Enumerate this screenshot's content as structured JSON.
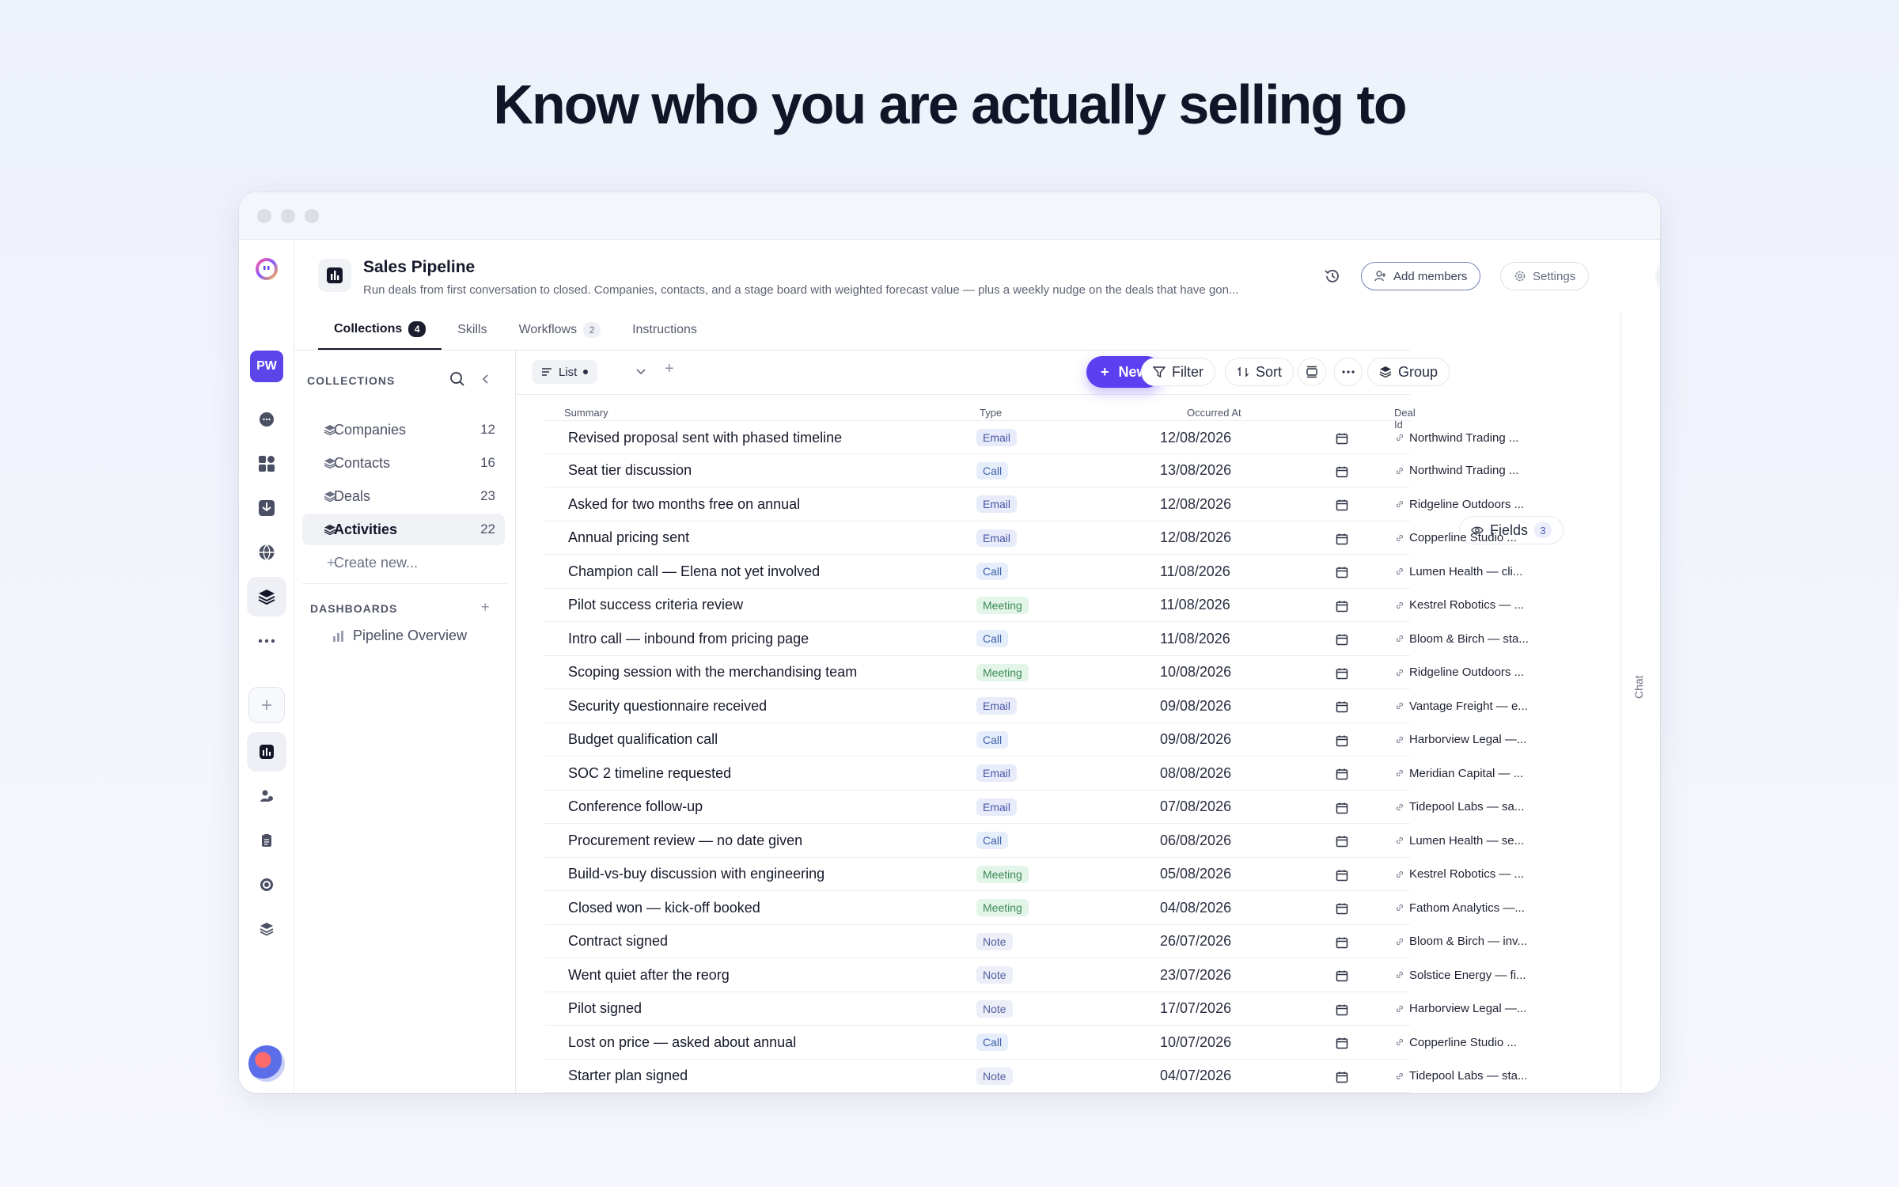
{
  "hero": {
    "title": "Know who you are actually selling to"
  },
  "workspace": {
    "initials": "PW"
  },
  "header": {
    "title": "Sales Pipeline",
    "description": "Run deals from first conversation to closed. Companies, contacts, and a stage board with weighted forecast value — plus a weekly nudge on the deals that have gon...",
    "add_members": "Add members",
    "settings": "Settings"
  },
  "tabs": [
    {
      "label": "Collections",
      "count": "4"
    },
    {
      "label": "Skills"
    },
    {
      "label": "Workflows",
      "count": "2"
    },
    {
      "label": "Instructions"
    }
  ],
  "sidebar": {
    "collections_heading": "COLLECTIONS",
    "collections": [
      {
        "label": "Companies",
        "count": "12"
      },
      {
        "label": "Contacts",
        "count": "16"
      },
      {
        "label": "Deals",
        "count": "23"
      },
      {
        "label": "Activities",
        "count": "22",
        "active": true
      }
    ],
    "create_new": "Create new...",
    "dashboards_heading": "DASHBOARDS",
    "dashboards": [
      {
        "label": "Pipeline Overview"
      }
    ]
  },
  "toolbar": {
    "view": "List",
    "new": "New",
    "filter": "Filter",
    "sort": "Sort",
    "group": "Group",
    "fields": "Fields",
    "fields_count": "3"
  },
  "right_panel": {
    "label": "Chat"
  },
  "table": {
    "columns": [
      "Summary",
      "Type",
      "Occurred At",
      "Deal Id"
    ],
    "rows": [
      {
        "summary": "Revised proposal sent with phased timeline",
        "type": "Email",
        "date": "12/08/2026",
        "deal": "Northwind Trading ..."
      },
      {
        "summary": "Seat tier discussion",
        "type": "Call",
        "date": "13/08/2026",
        "deal": "Northwind Trading ..."
      },
      {
        "summary": "Asked for two months free on annual",
        "type": "Email",
        "date": "12/08/2026",
        "deal": "Ridgeline Outdoors ..."
      },
      {
        "summary": "Annual pricing sent",
        "type": "Email",
        "date": "12/08/2026",
        "deal": "Copperline Studio ..."
      },
      {
        "summary": "Champion call — Elena not yet involved",
        "type": "Call",
        "date": "11/08/2026",
        "deal": "Lumen Health — cli..."
      },
      {
        "summary": "Pilot success criteria review",
        "type": "Meeting",
        "date": "11/08/2026",
        "deal": "Kestrel Robotics — ..."
      },
      {
        "summary": "Intro call — inbound from pricing page",
        "type": "Call",
        "date": "11/08/2026",
        "deal": "Bloom & Birch — sta..."
      },
      {
        "summary": "Scoping session with the merchandising team",
        "type": "Meeting",
        "date": "10/08/2026",
        "deal": "Ridgeline Outdoors ..."
      },
      {
        "summary": "Security questionnaire received",
        "type": "Email",
        "date": "09/08/2026",
        "deal": "Vantage Freight — e..."
      },
      {
        "summary": "Budget qualification call",
        "type": "Call",
        "date": "09/08/2026",
        "deal": "Harborview Legal —..."
      },
      {
        "summary": "SOC 2 timeline requested",
        "type": "Email",
        "date": "08/08/2026",
        "deal": "Meridian Capital — ..."
      },
      {
        "summary": "Conference follow-up",
        "type": "Email",
        "date": "07/08/2026",
        "deal": "Tidepool Labs — sa..."
      },
      {
        "summary": "Procurement review — no date given",
        "type": "Call",
        "date": "06/08/2026",
        "deal": "Lumen Health — se..."
      },
      {
        "summary": "Build-vs-buy discussion with engineering",
        "type": "Meeting",
        "date": "05/08/2026",
        "deal": "Kestrel Robotics — ..."
      },
      {
        "summary": "Closed won — kick-off booked",
        "type": "Meeting",
        "date": "04/08/2026",
        "deal": "Fathom Analytics —..."
      },
      {
        "summary": "Contract signed",
        "type": "Note",
        "date": "26/07/2026",
        "deal": "Bloom & Birch — inv..."
      },
      {
        "summary": "Went quiet after the reorg",
        "type": "Note",
        "date": "23/07/2026",
        "deal": "Solstice Energy — fi..."
      },
      {
        "summary": "Pilot signed",
        "type": "Note",
        "date": "17/07/2026",
        "deal": "Harborview Legal —..."
      },
      {
        "summary": "Lost on price — asked about annual",
        "type": "Call",
        "date": "10/07/2026",
        "deal": "Copperline Studio ..."
      },
      {
        "summary": "Starter plan signed",
        "type": "Note",
        "date": "04/07/2026",
        "deal": "Tidepool Labs — sta..."
      }
    ]
  }
}
